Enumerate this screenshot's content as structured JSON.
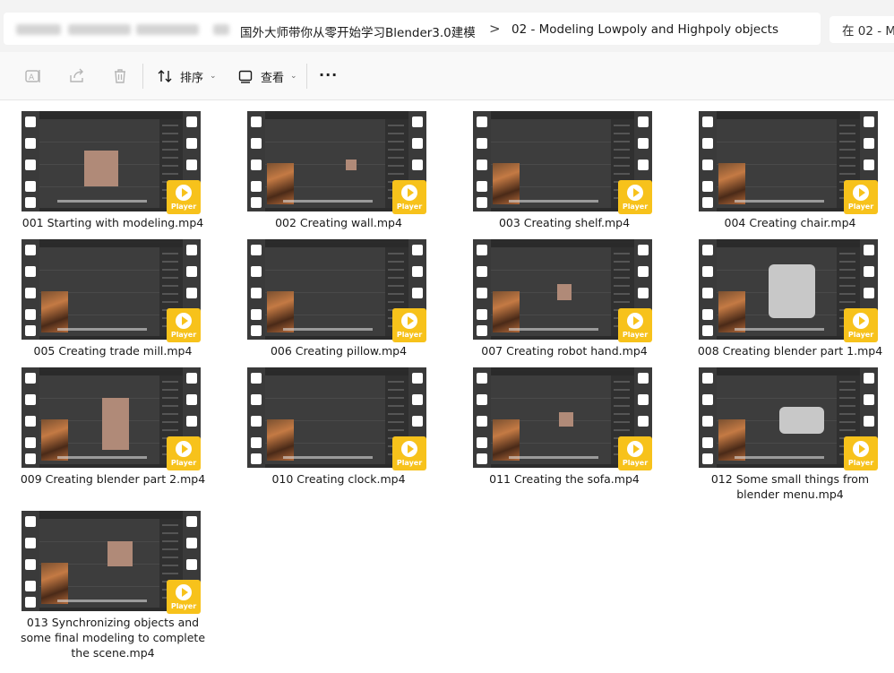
{
  "address": {
    "crumbs": [
      "国外大师带你从零开始学习Blender3.0建模",
      "02 - Modeling Lowpoly and Highpoly objects"
    ],
    "separator": ">",
    "search_placeholder": "在 02 - Mo"
  },
  "toolbar": {
    "sort_label": "排序",
    "view_label": "查看",
    "more_label": "···"
  },
  "colors": {
    "badge": "#f7c21b",
    "film": "#3a3a3a",
    "screen": "#3d3d3d"
  },
  "badge_label": "Player",
  "files": [
    {
      "name": "001 Starting with modeling.mp4"
    },
    {
      "name": "002 Creating wall.mp4"
    },
    {
      "name": "003 Creating shelf.mp4"
    },
    {
      "name": "004 Creating chair.mp4"
    },
    {
      "name": "005 Creating trade mill.mp4"
    },
    {
      "name": "006 Creating pillow.mp4"
    },
    {
      "name": "007 Creating robot hand.mp4"
    },
    {
      "name": "008 Creating blender part 1.mp4"
    },
    {
      "name": "009 Creating blender part 2.mp4"
    },
    {
      "name": "010 Creating clock.mp4"
    },
    {
      "name": "011 Creating the sofa.mp4"
    },
    {
      "name": "012 Some small things from blender menu.mp4"
    },
    {
      "name": "013 Synchronizing objects and some final modeling to complete the scene.mp4"
    }
  ]
}
